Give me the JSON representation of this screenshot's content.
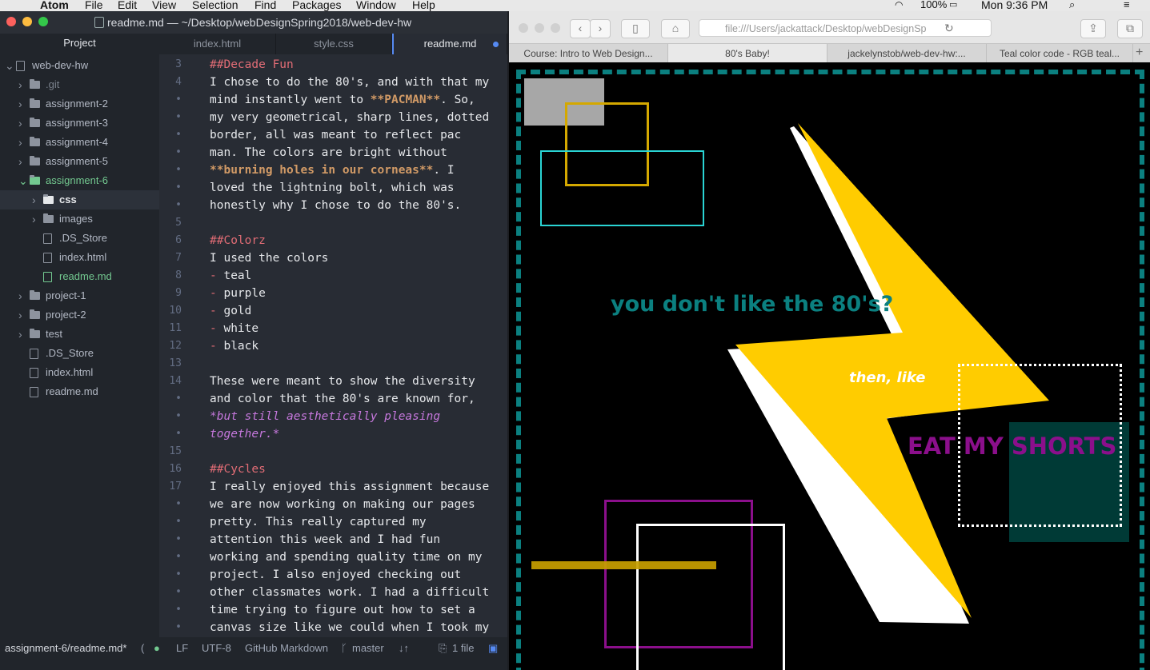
{
  "menubar": {
    "apple": "",
    "app_name": "Atom",
    "items": [
      "File",
      "Edit",
      "View",
      "Selection",
      "Find",
      "Packages",
      "Window",
      "Help"
    ],
    "battery": "100%",
    "clock": "Mon 9:36 PM"
  },
  "atom": {
    "window_title": "readme.md — ~/Desktop/webDesignSpring2018/web-dev-hw",
    "tree_header": "Project",
    "tree": [
      {
        "label": "web-dev-hw",
        "type": "repo",
        "depth": 0,
        "open": true
      },
      {
        "label": ".git",
        "type": "folder",
        "depth": 1,
        "open": false,
        "dim": true
      },
      {
        "label": "assignment-2",
        "type": "folder",
        "depth": 1,
        "open": false
      },
      {
        "label": "assignment-3",
        "type": "folder",
        "depth": 1,
        "open": false
      },
      {
        "label": "assignment-4",
        "type": "folder",
        "depth": 1,
        "open": false
      },
      {
        "label": "assignment-5",
        "type": "folder",
        "depth": 1,
        "open": false
      },
      {
        "label": "assignment-6",
        "type": "folder",
        "depth": 1,
        "open": true,
        "green": true
      },
      {
        "label": "css",
        "type": "folder",
        "depth": 2,
        "open": false,
        "selected": true
      },
      {
        "label": "images",
        "type": "folder",
        "depth": 2,
        "open": false
      },
      {
        "label": ".DS_Store",
        "type": "file",
        "depth": 2
      },
      {
        "label": "index.html",
        "type": "file",
        "depth": 2
      },
      {
        "label": "readme.md",
        "type": "md",
        "depth": 2,
        "green": true
      },
      {
        "label": "project-1",
        "type": "folder",
        "depth": 1,
        "open": false
      },
      {
        "label": "project-2",
        "type": "folder",
        "depth": 1,
        "open": false
      },
      {
        "label": "test",
        "type": "folder",
        "depth": 1,
        "open": false
      },
      {
        "label": ".DS_Store",
        "type": "file",
        "depth": 1
      },
      {
        "label": "index.html",
        "type": "file",
        "depth": 1
      },
      {
        "label": "readme.md",
        "type": "md",
        "depth": 1
      }
    ],
    "tabs": [
      {
        "label": "index.html",
        "active": false
      },
      {
        "label": "style.css",
        "active": false
      },
      {
        "label": "readme.md",
        "active": true,
        "modified": true
      }
    ],
    "editor_lines": [
      {
        "n": "3",
        "parts": [
          {
            "t": "##Decade Fun",
            "c": "hd"
          }
        ]
      },
      {
        "n": "4",
        "parts": [
          {
            "t": "I chose to do the 80's, and with that my"
          }
        ]
      },
      {
        "n": "•",
        "parts": [
          {
            "t": "mind instantly went to "
          },
          {
            "t": "**PACMAN**",
            "c": "bold"
          },
          {
            "t": ". So,"
          }
        ]
      },
      {
        "n": "•",
        "parts": [
          {
            "t": "my very geometrical, sharp lines, dotted"
          }
        ]
      },
      {
        "n": "•",
        "parts": [
          {
            "t": "border, all was meant to reflect pac"
          }
        ]
      },
      {
        "n": "•",
        "parts": [
          {
            "t": "man. The colors are bright without"
          }
        ]
      },
      {
        "n": "•",
        "parts": [
          {
            "t": "**burning holes in our corneas**",
            "c": "bold"
          },
          {
            "t": ". I"
          }
        ]
      },
      {
        "n": "•",
        "parts": [
          {
            "t": "loved the lightning bolt, which was"
          }
        ]
      },
      {
        "n": "•",
        "parts": [
          {
            "t": "honestly why I chose to do the 80's."
          }
        ]
      },
      {
        "n": "5",
        "parts": []
      },
      {
        "n": "6",
        "parts": [
          {
            "t": "##Colorz",
            "c": "hd"
          }
        ]
      },
      {
        "n": "7",
        "parts": [
          {
            "t": "I used the colors"
          }
        ]
      },
      {
        "n": "8",
        "parts": [
          {
            "t": "- ",
            "c": "dash"
          },
          {
            "t": "teal"
          }
        ]
      },
      {
        "n": "9",
        "parts": [
          {
            "t": "- ",
            "c": "dash"
          },
          {
            "t": "purple"
          }
        ]
      },
      {
        "n": "10",
        "parts": [
          {
            "t": "- ",
            "c": "dash"
          },
          {
            "t": "gold"
          }
        ]
      },
      {
        "n": "11",
        "parts": [
          {
            "t": "- ",
            "c": "dash"
          },
          {
            "t": "white"
          }
        ]
      },
      {
        "n": "12",
        "parts": [
          {
            "t": "- ",
            "c": "dash"
          },
          {
            "t": "black"
          }
        ]
      },
      {
        "n": "13",
        "parts": []
      },
      {
        "n": "14",
        "parts": [
          {
            "t": "These were meant to show the diversity"
          }
        ]
      },
      {
        "n": "•",
        "parts": [
          {
            "t": "and color that the 80's are known for,"
          }
        ]
      },
      {
        "n": "•",
        "parts": [
          {
            "t": "*but still aesthetically pleasing",
            "c": "ital"
          }
        ]
      },
      {
        "n": "•",
        "parts": [
          {
            "t": "together.*",
            "c": "ital"
          }
        ]
      },
      {
        "n": "15",
        "parts": []
      },
      {
        "n": "16",
        "parts": [
          {
            "t": "##Cycles",
            "c": "hd"
          }
        ]
      },
      {
        "n": "17",
        "parts": [
          {
            "t": "I really enjoyed this assignment because"
          }
        ]
      },
      {
        "n": "•",
        "parts": [
          {
            "t": "we are now working on making our pages"
          }
        ]
      },
      {
        "n": "•",
        "parts": [
          {
            "t": "pretty. This really captured my"
          }
        ]
      },
      {
        "n": "•",
        "parts": [
          {
            "t": "attention this week and I had fun"
          }
        ]
      },
      {
        "n": "•",
        "parts": [
          {
            "t": "working and spending quality time on my"
          }
        ]
      },
      {
        "n": "•",
        "parts": [
          {
            "t": "project. I also enjoyed checking out"
          }
        ]
      },
      {
        "n": "•",
        "parts": [
          {
            "t": "other classmates work. I had a difficult"
          }
        ]
      },
      {
        "n": "•",
        "parts": [
          {
            "t": "time trying to figure out how to set a"
          }
        ]
      },
      {
        "n": "•",
        "parts": [
          {
            "t": "canvas size like we could when I took my"
          }
        ]
      },
      {
        "n": "•",
        "parts": []
      }
    ],
    "status": {
      "path": "assignment-6/readme.md*",
      "line_ending": "LF",
      "encoding": "UTF-8",
      "grammar": "GitHub Markdown",
      "branch": "master",
      "files": "1 file"
    }
  },
  "browser": {
    "address": "file:///Users/jackattack/Desktop/webDesignSp",
    "tabs": [
      "Course: Intro to Web Design...",
      "80's Baby!",
      "jackelynstob/web-dev-hw:...",
      "Teal color code - RGB teal..."
    ],
    "page": {
      "text_main": "you don't like the 80's?",
      "text_then": "then, like",
      "text_eat": "EAT MY SHORTS"
    }
  },
  "colors": {
    "teal": "#0b8080",
    "gold": "#ffcc00",
    "purple": "#8b0f8b",
    "cyan": "#2ad4d4",
    "mustard": "#c8a000",
    "darkteal": "#003a36"
  }
}
